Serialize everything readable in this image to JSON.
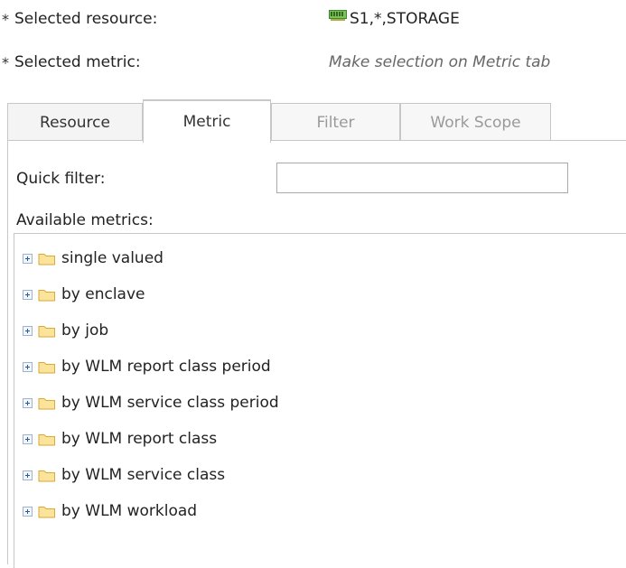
{
  "header": {
    "resource_label": "Selected resource:",
    "resource_value": "S1,*,STORAGE",
    "metric_label": "Selected metric:",
    "metric_value": "Make selection on Metric tab",
    "required_marker": "*"
  },
  "tabs": [
    {
      "label": "Resource",
      "state": "normal"
    },
    {
      "label": "Metric",
      "state": "active"
    },
    {
      "label": "Filter",
      "state": "disabled"
    },
    {
      "label": "Work Scope",
      "state": "disabled"
    }
  ],
  "quick_filter": {
    "label": "Quick filter:",
    "value": "",
    "placeholder": ""
  },
  "available_metrics": {
    "label": "Available metrics:",
    "items": [
      {
        "label": "single valued",
        "icon": "folder-icon"
      },
      {
        "label": "by enclave",
        "icon": "folder-icon"
      },
      {
        "label": "by job",
        "icon": "folder-icon"
      },
      {
        "label": "by WLM report class period",
        "icon": "folder-icon"
      },
      {
        "label": "by WLM service class period",
        "icon": "folder-icon"
      },
      {
        "label": "by WLM report class",
        "icon": "folder-icon"
      },
      {
        "label": "by WLM service class",
        "icon": "folder-icon"
      },
      {
        "label": "by WLM workload",
        "icon": "folder-icon"
      }
    ]
  },
  "colors": {
    "folder_fill": "#fbe39a",
    "folder_stroke": "#d9a93a",
    "resource_icon": "#3c8a2e",
    "tab_border": "#c7c7c7"
  }
}
